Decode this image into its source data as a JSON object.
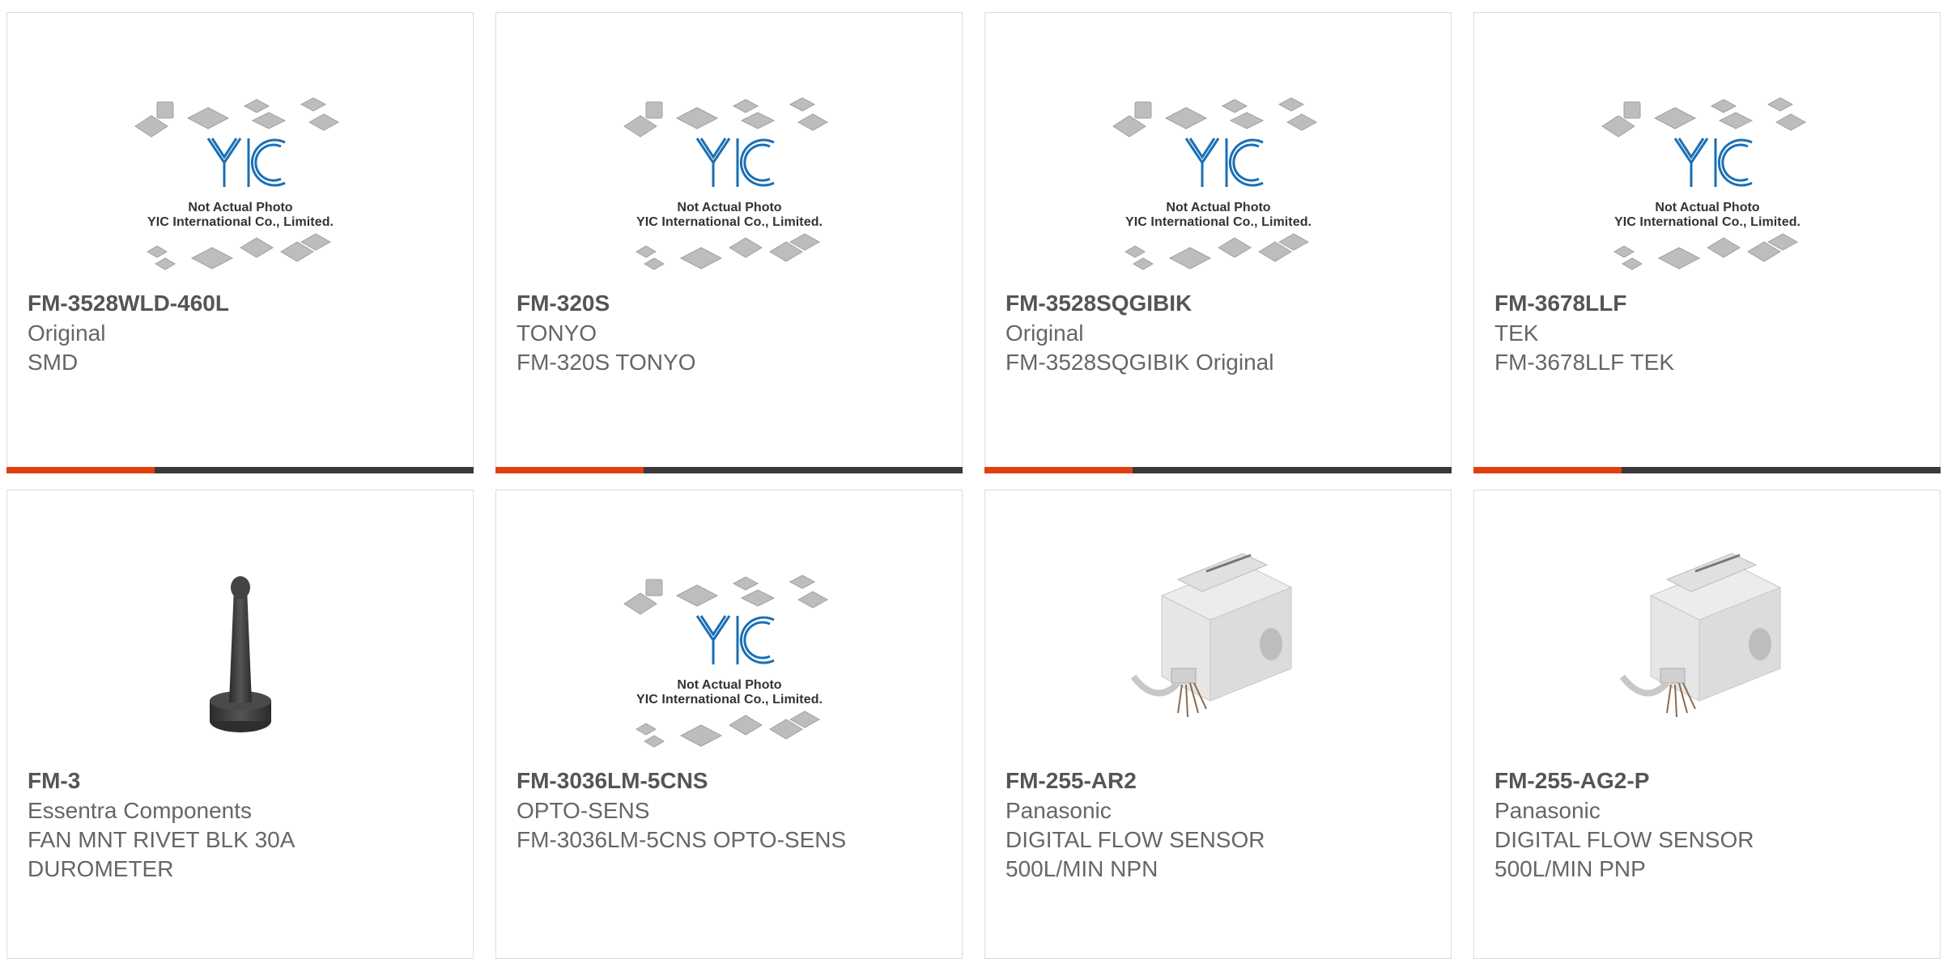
{
  "colors": {
    "accent": "#e04010",
    "bar": "#3a3a3a",
    "part_number": "#555555",
    "text": "#666666",
    "logo": "#1a6fb5"
  },
  "placeholder": {
    "caption1": "Not Actual Photo",
    "caption2": "YIC International Co., Limited.",
    "logo": "YIC"
  },
  "products": [
    {
      "pn": "FM-3528WLD-460L",
      "mfr": "Original",
      "desc1": "SMD",
      "desc2": "",
      "image": "placeholder"
    },
    {
      "pn": "FM-320S",
      "mfr": "TONYO",
      "desc1": "FM-320S TONYO",
      "desc2": "",
      "image": "placeholder"
    },
    {
      "pn": "FM-3528SQGIBIK",
      "mfr": "Original",
      "desc1": "FM-3528SQGIBIK Original",
      "desc2": "",
      "image": "placeholder"
    },
    {
      "pn": "FM-3678LLF",
      "mfr": "TEK",
      "desc1": "FM-3678LLF TEK",
      "desc2": "",
      "image": "placeholder"
    },
    {
      "pn": "FM-3",
      "mfr": "Essentra Components",
      "desc1": "FAN MNT RIVET BLK 30A",
      "desc2": "DUROMETER",
      "image": "rivet-photo"
    },
    {
      "pn": "FM-3036LM-5CNS",
      "mfr": "OPTO-SENS",
      "desc1": "FM-3036LM-5CNS OPTO-SENS",
      "desc2": "",
      "image": "placeholder"
    },
    {
      "pn": "FM-255-AR2",
      "mfr": "Panasonic",
      "desc1": "DIGITAL FLOW SENSOR",
      "desc2": "500L/MIN NPN",
      "image": "flow-sensor-photo"
    },
    {
      "pn": "FM-255-AG2-P",
      "mfr": "Panasonic",
      "desc1": "DIGITAL FLOW SENSOR",
      "desc2": "500L/MIN PNP",
      "image": "flow-sensor-photo"
    }
  ]
}
